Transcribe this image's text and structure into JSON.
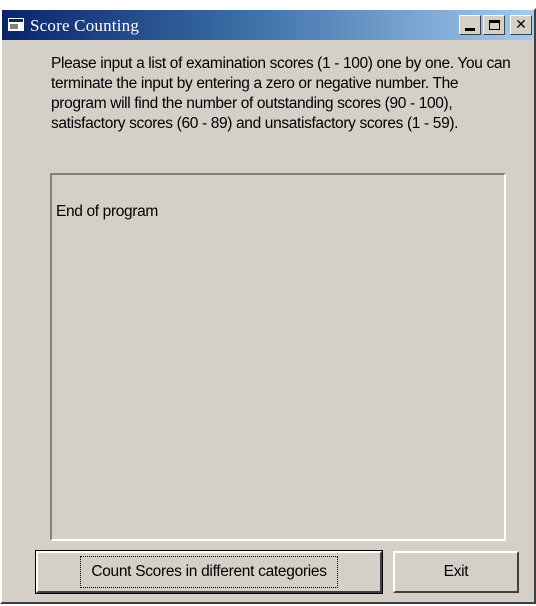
{
  "window": {
    "title": "Score Counting",
    "caption_buttons": {
      "minimize_icon": "minimize-icon",
      "maximize_icon": "maximize-icon",
      "close_glyph": "✕"
    }
  },
  "instructions": "Please input a list of examination scores (1 - 100) one by one. You can terminate the input by entering a zero or negative number. The program will find the number of outstanding scores (90 - 100), satisfactory scores (60 - 89) and unsatisfactory scores (1 - 59).",
  "output": {
    "text": "End of program"
  },
  "buttons": {
    "count_label": "Count Scores in different categories",
    "exit_label": "Exit"
  },
  "colors": {
    "titlebar_start": "#0a246a",
    "titlebar_end": "#a6caf0",
    "face": "#d4d0c8"
  }
}
